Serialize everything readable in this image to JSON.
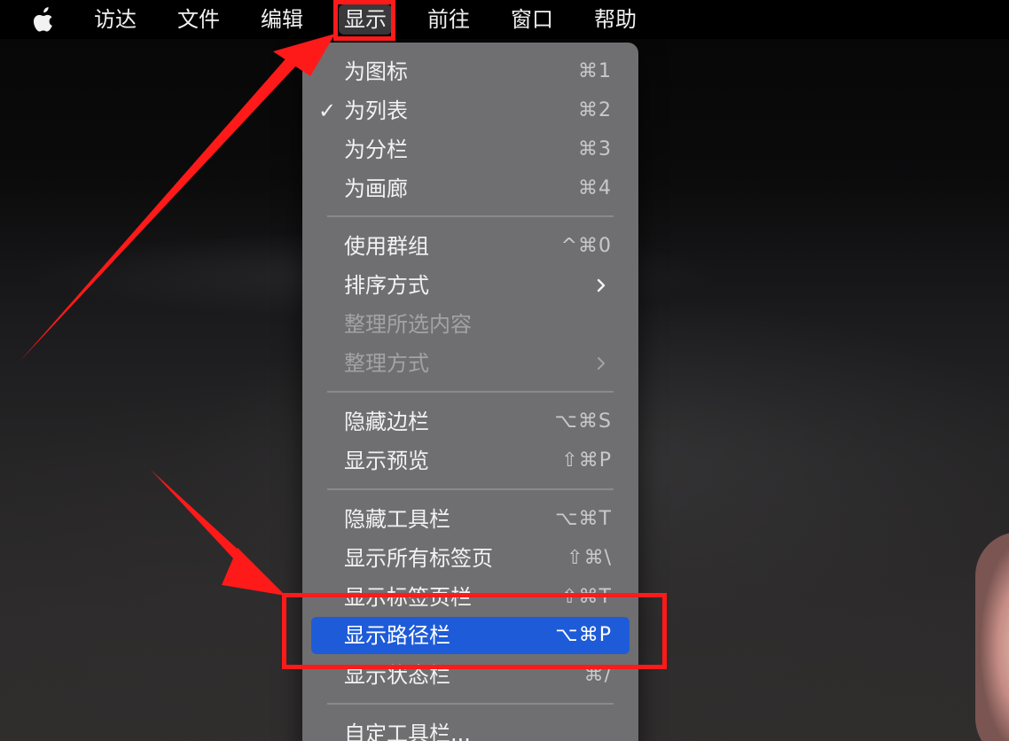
{
  "menubar": {
    "apple_icon": "apple-logo-icon",
    "items": [
      {
        "label": "访达"
      },
      {
        "label": "文件"
      },
      {
        "label": "编辑"
      },
      {
        "label": "显示"
      },
      {
        "label": "前往"
      },
      {
        "label": "窗口"
      },
      {
        "label": "帮助"
      }
    ],
    "active_item": "显示"
  },
  "view_menu": {
    "items": [
      {
        "label": "为图标",
        "shortcut": "⌘1"
      },
      {
        "label": "为列表",
        "shortcut": "⌘2",
        "checked": true,
        "check_mark": "✓"
      },
      {
        "label": "为分栏",
        "shortcut": "⌘3"
      },
      {
        "label": "为画廊",
        "shortcut": "⌘4"
      },
      {
        "label": "使用群组",
        "shortcut": "^⌘0"
      },
      {
        "label": "排序方式",
        "submenu": true,
        "submenu_icon": "chevron-right-icon"
      },
      {
        "label": "整理所选内容",
        "disabled": true
      },
      {
        "label": "整理方式",
        "disabled": true,
        "submenu": true,
        "submenu_icon": "chevron-right-icon"
      },
      {
        "label": "隐藏边栏",
        "shortcut": "⌥⌘S"
      },
      {
        "label": "显示预览",
        "shortcut": "⇧⌘P"
      },
      {
        "label": "隐藏工具栏",
        "shortcut": "⌥⌘T"
      },
      {
        "label": "显示所有标签页",
        "shortcut": "⇧⌘\\"
      },
      {
        "label": "显示标签页栏",
        "shortcut": "⇧⌘T"
      },
      {
        "label": "显示路径栏",
        "shortcut": "⌥⌘P",
        "highlighted": true
      },
      {
        "label": "显示状态栏",
        "shortcut": "⌘/"
      },
      {
        "label": "自定工具栏..."
      }
    ]
  },
  "colors": {
    "menubar_bg": "#000000",
    "menu_bg": "#6f6f72",
    "highlight": "#1e5bd8",
    "annotation": "#ff1a1a"
  }
}
